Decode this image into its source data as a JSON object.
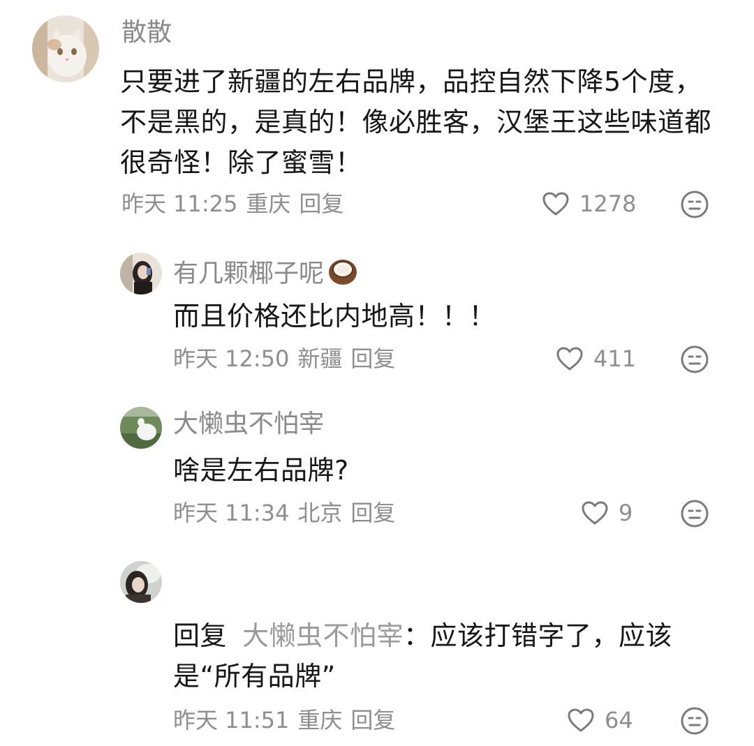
{
  "comments": [
    {
      "username": "散散",
      "text": "只要进了新疆的左右品牌，品控自然下降5个度，不是黑的，是真的！像必胜客，汉堡王这些味道都很奇怪！除了蜜雪！",
      "time": "昨天 11:25",
      "location": "重庆",
      "reply_label": "回复",
      "likes": "1278"
    },
    {
      "username": "有几颗椰子呢",
      "username_emoji": "🥥",
      "text": "而且价格还比内地高！！！",
      "time": "昨天 12:50",
      "location": "新疆",
      "reply_label": "回复",
      "likes": "411"
    },
    {
      "username": "大懒虫不怕宰",
      "text": "啥是左右品牌?",
      "time": "昨天 11:34",
      "location": "北京",
      "reply_label": "回复",
      "likes": "9"
    },
    {
      "username": "",
      "reply_prefix": "回复",
      "reply_target": "大懒虫不怕宰",
      "text": "：应该打错字了，应该是“所有品牌”",
      "time": "昨天 11:51",
      "location": "重庆",
      "reply_label": "回复",
      "likes": "64"
    }
  ],
  "icons": {
    "like": "heart-outline-icon",
    "react": "meh-face-icon"
  },
  "colors": {
    "text_primary": "#161616",
    "text_secondary": "#8e8e8e",
    "icon_gray": "#7a7a7a"
  }
}
